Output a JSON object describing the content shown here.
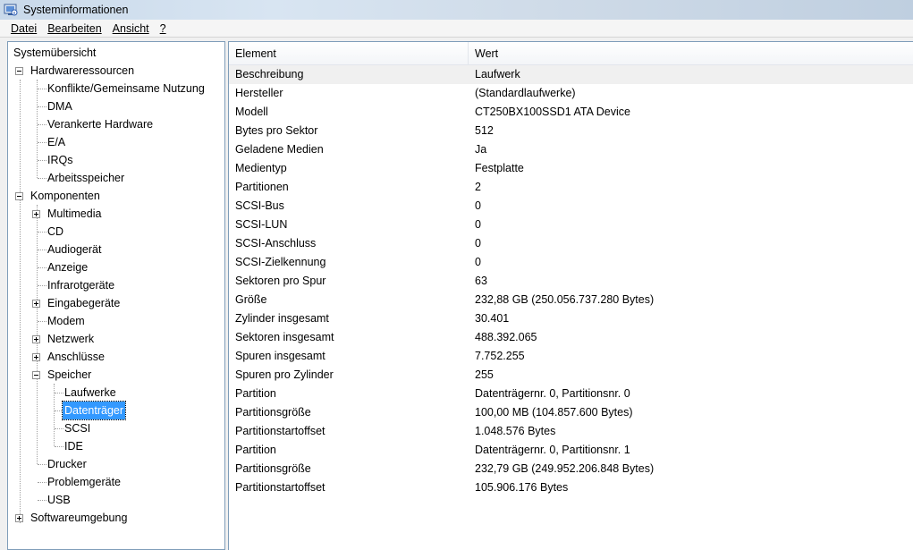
{
  "window": {
    "title": "Systeminformationen"
  },
  "menu": [
    {
      "label": "Datei"
    },
    {
      "label": "Bearbeiten"
    },
    {
      "label": "Ansicht"
    },
    {
      "label": "?"
    }
  ],
  "tree": {
    "root": "Systemübersicht",
    "hardware": "Hardwareressourcen",
    "hardware_items": [
      "Konflikte/Gemeinsame Nutzung",
      "DMA",
      "Verankerte Hardware",
      "E/A",
      "IRQs",
      "Arbeitsspeicher"
    ],
    "components": "Komponenten",
    "multimedia": "Multimedia",
    "cd": "CD",
    "audio": "Audiogerät",
    "display": "Anzeige",
    "infrared": "Infrarotgeräte",
    "input": "Eingabegeräte",
    "modem": "Modem",
    "network": "Netzwerk",
    "ports": "Anschlüsse",
    "storage": "Speicher",
    "storage_items": [
      "Laufwerke",
      "Datenträger",
      "SCSI",
      "IDE"
    ],
    "printers": "Drucker",
    "problem_devices": "Problemgeräte",
    "usb": "USB",
    "software": "Softwareumgebung"
  },
  "details": {
    "col_element": "Element",
    "col_value": "Wert",
    "rows": [
      {
        "element": "Beschreibung",
        "value": "Laufwerk"
      },
      {
        "element": "Hersteller",
        "value": "(Standardlaufwerke)"
      },
      {
        "element": "Modell",
        "value": "CT250BX100SSD1 ATA Device"
      },
      {
        "element": "Bytes pro Sektor",
        "value": "512"
      },
      {
        "element": "Geladene Medien",
        "value": "Ja"
      },
      {
        "element": "Medientyp",
        "value": "Festplatte"
      },
      {
        "element": "Partitionen",
        "value": "2"
      },
      {
        "element": "SCSI-Bus",
        "value": "0"
      },
      {
        "element": "SCSI-LUN",
        "value": "0"
      },
      {
        "element": "SCSI-Anschluss",
        "value": "0"
      },
      {
        "element": "SCSI-Zielkennung",
        "value": "0"
      },
      {
        "element": "Sektoren pro Spur",
        "value": "63"
      },
      {
        "element": "Größe",
        "value": "232,88 GB (250.056.737.280 Bytes)"
      },
      {
        "element": "Zylinder insgesamt",
        "value": "30.401"
      },
      {
        "element": "Sektoren insgesamt",
        "value": "488.392.065"
      },
      {
        "element": "Spuren insgesamt",
        "value": "7.752.255"
      },
      {
        "element": "Spuren pro Zylinder",
        "value": "255"
      },
      {
        "element": "Partition",
        "value": "Datenträgernr. 0, Partitionsnr. 0"
      },
      {
        "element": "Partitionsgröße",
        "value": "100,00 MB (104.857.600 Bytes)"
      },
      {
        "element": "Partitionstartoffset",
        "value": "1.048.576 Bytes"
      },
      {
        "element": "Partition",
        "value": "Datenträgernr. 0, Partitionsnr. 1"
      },
      {
        "element": "Partitionsgröße",
        "value": "232,79 GB (249.952.206.848 Bytes)"
      },
      {
        "element": "Partitionstartoffset",
        "value": "105.906.176 Bytes"
      }
    ]
  }
}
